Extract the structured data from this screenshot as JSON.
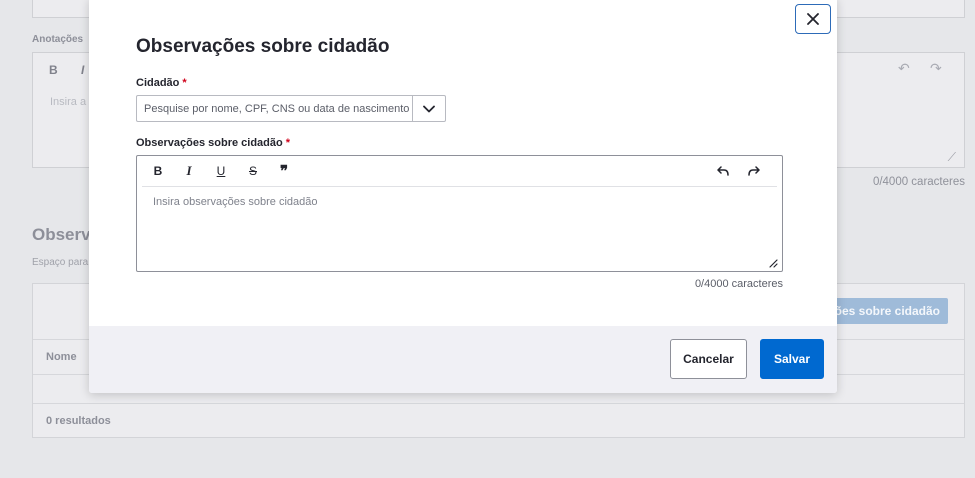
{
  "background": {
    "annotations_label": "Anotações",
    "editor_placeholder": "Insira a",
    "counter": "0/4000 caracteres",
    "section_title": "Observ",
    "section_subtitle": "Espaço para",
    "add_button": "ações sobre cidadão",
    "table_header": "Nome",
    "results": "0 resultados",
    "toolbar_bold": "B",
    "toolbar_italic": "I"
  },
  "modal": {
    "title": "Observações sobre cidadão",
    "close_icon": "close-icon",
    "citizen_field": {
      "label": "Cidadão",
      "required_mark": "*",
      "placeholder": "Pesquise por nome, CPF, CNS ou data de nascimento",
      "value": ""
    },
    "observations_field": {
      "label": "Observações sobre cidadão",
      "required_mark": "*",
      "placeholder": "Insira observações sobre cidadão",
      "value": "",
      "toolbar": {
        "bold": "B",
        "italic": "I",
        "underline": "U",
        "strikethrough": "S",
        "quote": "❞",
        "undo_icon": "undo-icon",
        "redo_icon": "redo-icon"
      },
      "counter": "0/4000 caracteres"
    },
    "footer": {
      "cancel_label": "Cancelar",
      "save_label": "Salvar"
    }
  },
  "colors": {
    "primary": "#0069d0",
    "required": "#d0021b",
    "close_border": "#2d6bb8",
    "overlay_bg": "#e6e7ea"
  }
}
